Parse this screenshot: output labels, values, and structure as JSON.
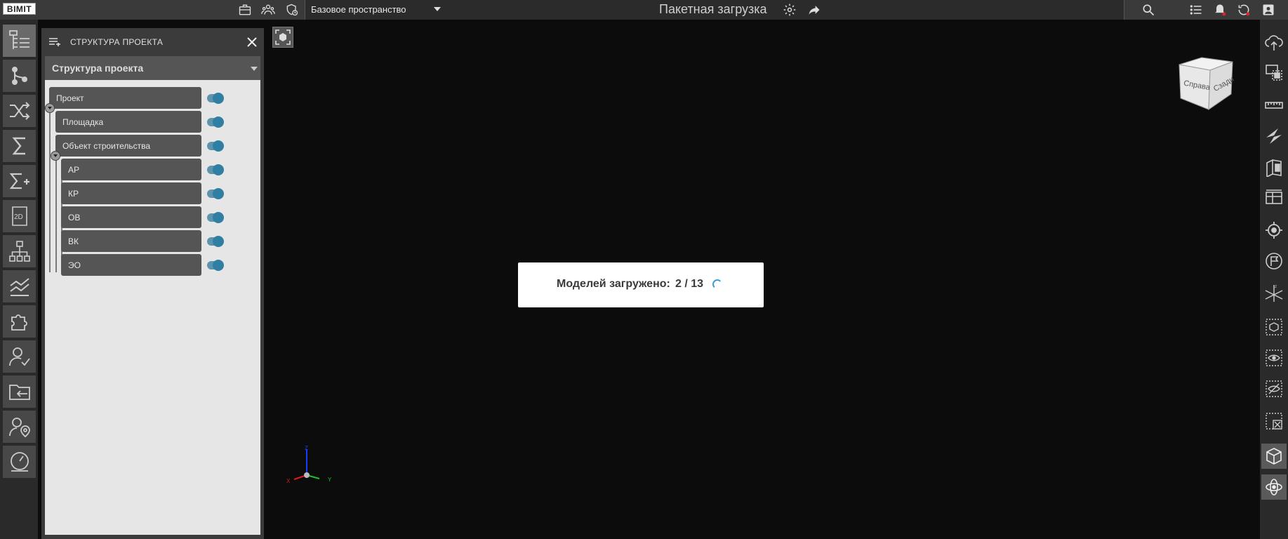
{
  "app": {
    "logo": "BIMIT"
  },
  "topbar": {
    "workspace": "Базовое пространство",
    "title": "Пакетная загрузка"
  },
  "panel": {
    "header": "СТРУКТУРА ПРОЕКТА",
    "selector": "Структура проекта",
    "tree": [
      {
        "label": "Проект",
        "level": 0,
        "enabled": true
      },
      {
        "label": "Площадка",
        "level": 1,
        "enabled": true
      },
      {
        "label": "Объект строительства",
        "level": 1,
        "enabled": true
      },
      {
        "label": "АР",
        "level": 2,
        "enabled": true
      },
      {
        "label": "КР",
        "level": 2,
        "enabled": true
      },
      {
        "label": "ОВ",
        "level": 2,
        "enabled": true
      },
      {
        "label": "ВК",
        "level": 2,
        "enabled": true
      },
      {
        "label": "ЭО",
        "level": 2,
        "enabled": true
      }
    ]
  },
  "loader": {
    "label": "Моделей загружено:",
    "value": "2 / 13"
  },
  "viewcube": {
    "left_face": "Справа",
    "right_face": "Сзади"
  },
  "axes": {
    "x": "X",
    "y": "Y",
    "z": "Z"
  },
  "colors": {
    "accent": "#2f7fa3",
    "toggle_track": "#5d93ad",
    "loader_spinner": "#3b9fd0"
  }
}
